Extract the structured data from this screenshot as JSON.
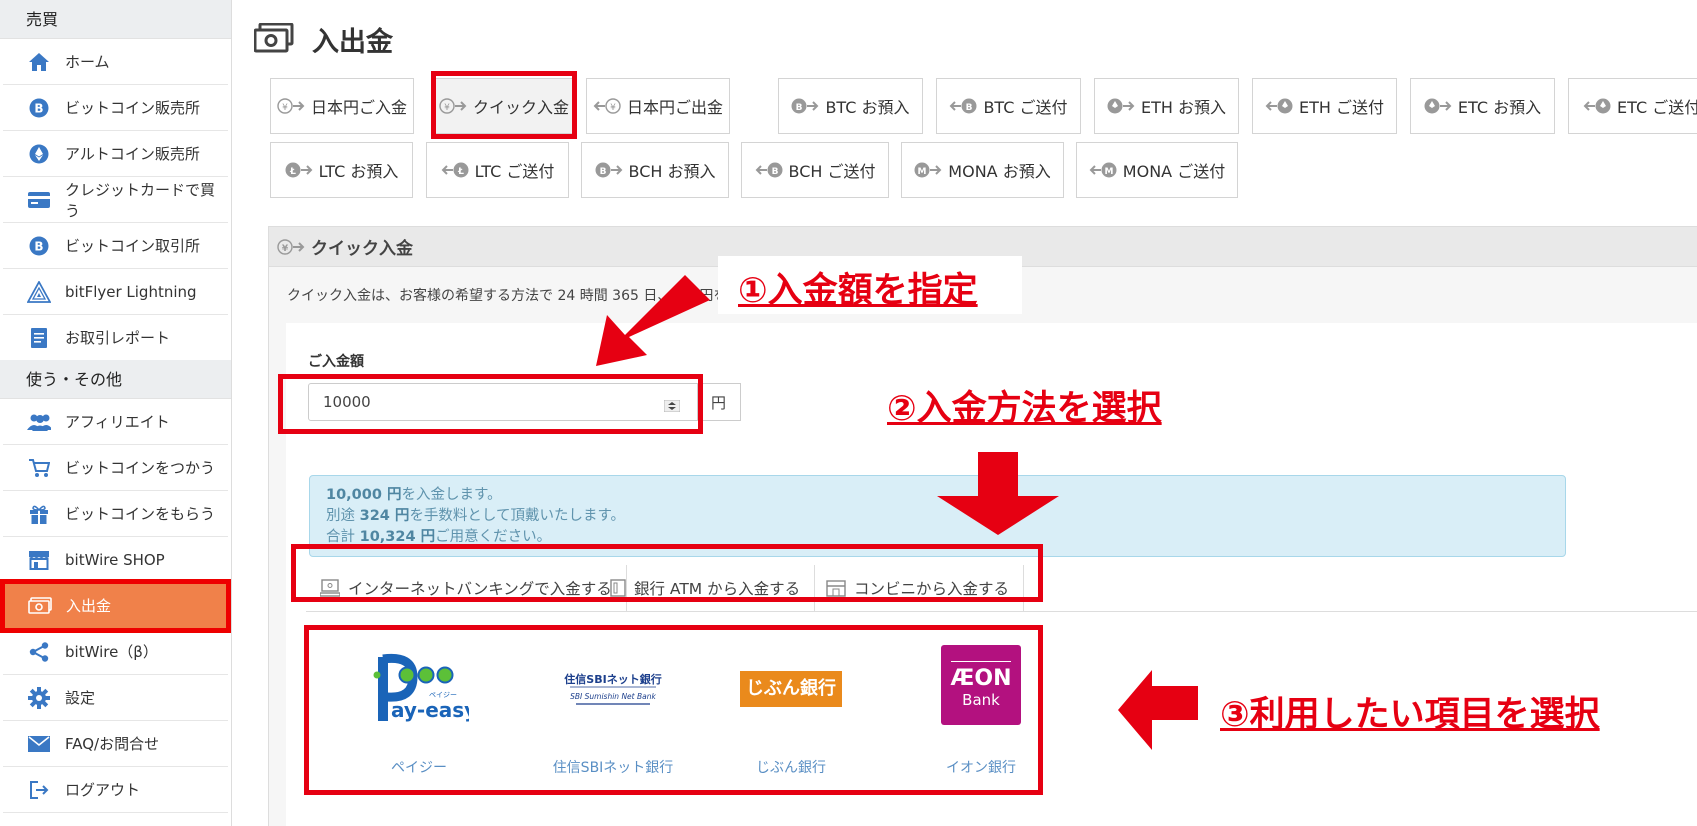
{
  "sidebar": {
    "section_trade": "売買",
    "section_other": "使う・その他",
    "items": [
      {
        "label": "ホーム"
      },
      {
        "label": "ビットコイン販売所"
      },
      {
        "label": "アルトコイン販売所"
      },
      {
        "label": "クレジットカードで買う"
      },
      {
        "label": "ビットコイン取引所"
      },
      {
        "label": "bitFlyer Lightning"
      },
      {
        "label": "お取引レポート"
      },
      {
        "label": "アフィリエイト"
      },
      {
        "label": "ビットコインをつかう"
      },
      {
        "label": "ビットコインをもらう"
      },
      {
        "label": "bitWire SHOP"
      },
      {
        "label": "入出金"
      },
      {
        "label": "bitWire（β）"
      },
      {
        "label": "設定"
      },
      {
        "label": "FAQ/お問合せ"
      },
      {
        "label": "ログアウト"
      }
    ]
  },
  "page": {
    "title": "入出金"
  },
  "tabs": [
    {
      "label": "日本円ご入金"
    },
    {
      "label": "クイック入金"
    },
    {
      "label": "日本円ご出金"
    },
    {
      "label": "BTC お預入"
    },
    {
      "label": "BTC ご送付"
    },
    {
      "label": "ETH お預入"
    },
    {
      "label": "ETH ご送付"
    },
    {
      "label": "ETC お預入"
    },
    {
      "label": "ETC ご送付"
    },
    {
      "label": "LTC お預入"
    },
    {
      "label": "LTC ご送付"
    },
    {
      "label": "BCH お預入"
    },
    {
      "label": "BCH ご送付"
    },
    {
      "label": "MONA お預入"
    },
    {
      "label": "MONA ご送付"
    }
  ],
  "panel": {
    "title": "クイック入金",
    "description": "クイック入金は、お客様の希望する方法で 24 時間 365 日、日本円を",
    "amount_label": "ご入金額",
    "amount_value": "10000",
    "currency": "円",
    "info": {
      "line1_amount": "10,000 円",
      "line1_text": "を入金します。",
      "line2_prefix": "別途 ",
      "line2_amount": "324 円",
      "line2_text": "を手数料として頂戴いたします。",
      "line3_prefix": "合計 ",
      "line3_amount": "10,324 円",
      "line3_text": "ご用意ください。"
    },
    "methods": [
      {
        "label": "インターネットバンキングで入金する"
      },
      {
        "label": "銀行 ATM から入金する"
      },
      {
        "label": "コンビニから入金する"
      }
    ],
    "banks": [
      {
        "label": "ペイジー",
        "logo_main": "ay-easy",
        "logo_sub": "ペイジー"
      },
      {
        "label": "住信SBIネット銀行",
        "logo_main": "住信SBIネット銀行",
        "logo_sub": "SBI Sumishin Net Bank"
      },
      {
        "label": "じぶん銀行",
        "logo_main": "じぶん銀行"
      },
      {
        "label": "イオン銀行",
        "logo_main": "ÆON",
        "logo_sub": "Bank"
      }
    ]
  },
  "annotations": {
    "step1": "①入金額を指定",
    "step2": "②入金方法を選択",
    "step3": "③利用したい項目を選択"
  },
  "colors": {
    "accent_orange": "#f0814a",
    "highlight_red": "#e60012",
    "info_bg": "#d9eef7",
    "link_blue": "#5a8fc4",
    "sidebar_icon_blue": "#3a78c4"
  }
}
